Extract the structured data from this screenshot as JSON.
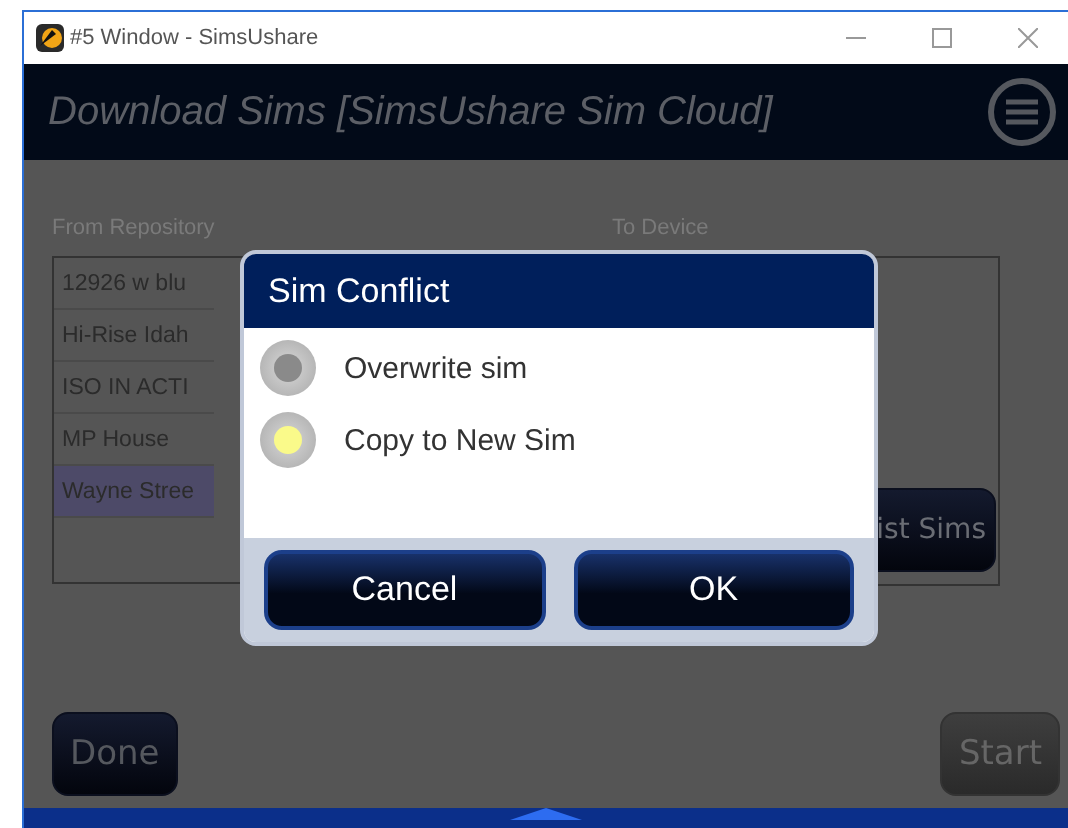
{
  "window": {
    "title": "#5 Window - SimsUshare"
  },
  "header": {
    "title": "Download Sims [SimsUshare Sim Cloud]"
  },
  "from_repository": {
    "label": "From Repository",
    "items": [
      {
        "name": "12926 w blu",
        "selected": false
      },
      {
        "name": "Hi-Rise Idah",
        "selected": false
      },
      {
        "name": "ISO IN ACTI",
        "selected": false
      },
      {
        "name": "MP House",
        "selected": false
      },
      {
        "name": "Wayne Stree",
        "selected": true
      }
    ]
  },
  "to_device": {
    "label": "To Device",
    "button": "ist Sims"
  },
  "footer": {
    "done": "Done",
    "start": "Start",
    "start_disabled": true
  },
  "dialog": {
    "title": "Sim Conflict",
    "options": [
      {
        "label": "Overwrite sim",
        "selected": false
      },
      {
        "label": "Copy to New Sim",
        "selected": true
      }
    ],
    "buttons": [
      "Cancel",
      "OK"
    ]
  }
}
